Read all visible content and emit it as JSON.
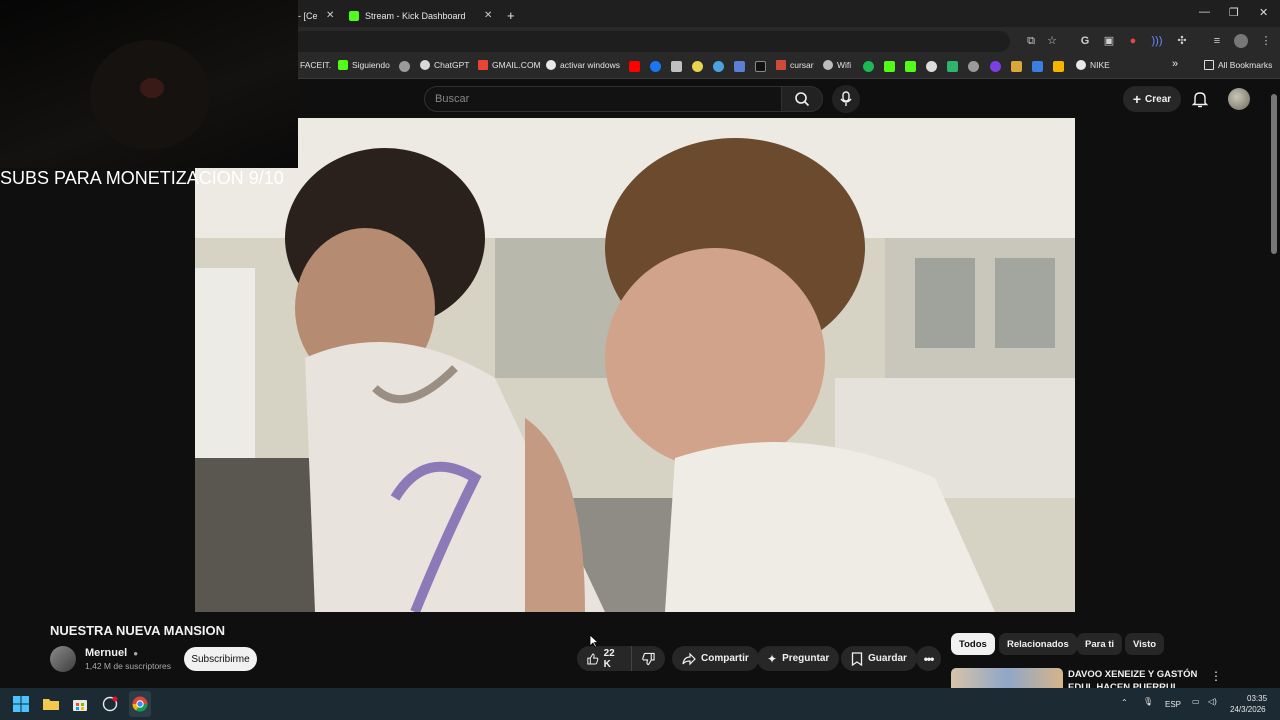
{
  "browser": {
    "tabs": [
      {
        "label": "- [Ce"
      },
      {
        "label": "Stream - Kick Dashboard"
      }
    ],
    "new_tab": "+",
    "bookmarks": [
      "FACEIT.",
      "Siguiendo",
      "ChatGPT",
      "GMAIL.COM",
      "activar windows",
      "cursar",
      "Wifi",
      "NIKE"
    ],
    "all_bookmarks": "All Bookmarks",
    "more": "»"
  },
  "header": {
    "search_placeholder": "Buscar",
    "create_label": "Crear"
  },
  "stream_overlay": {
    "text": "SUBS PARA MONETIZACION 9/10"
  },
  "video": {
    "title": "NUESTRA NUEVA MANSION",
    "channel": "Mernuel",
    "subscribers": "1,42 M de suscriptores",
    "subscribe_label": "Subscribirme",
    "likes": "22 K",
    "share_label": "Compartir",
    "ask_label": "Preguntar",
    "save_label": "Guardar"
  },
  "sidebar": {
    "chips": [
      "Todos",
      "Relacionados",
      "Para ti",
      "Visto"
    ],
    "recommendation_title": "DAVOO XENEIZE Y GASTÓN EDUL HACEN PUERRUL"
  },
  "taskbar": {
    "lang": "ESP",
    "time": "03:35",
    "date": "24/3/2026"
  },
  "colors": {
    "kick_green": "#53fc18",
    "youtube_bg": "#0f0f0f"
  }
}
